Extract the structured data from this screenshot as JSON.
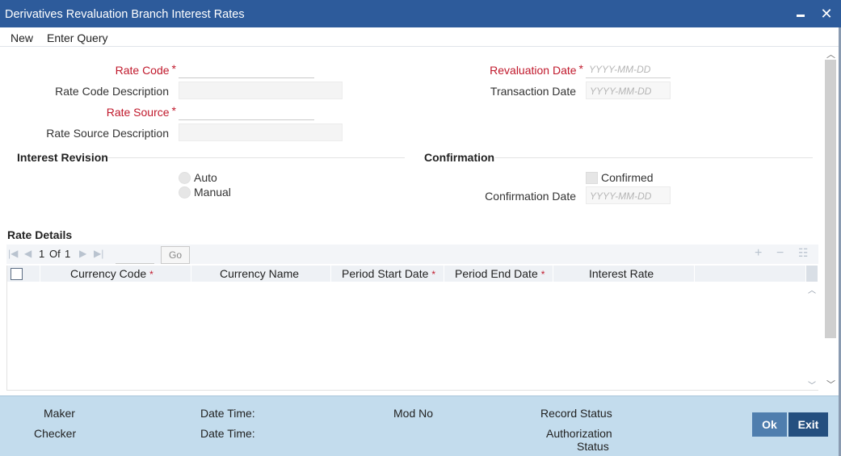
{
  "window": {
    "title": "Derivatives Revaluation Branch Interest Rates",
    "minimize_icon": "minimize-icon",
    "close_glyph": "✕"
  },
  "menu": {
    "new": "New",
    "enter_query": "Enter Query"
  },
  "form": {
    "rate_code_label": "Rate Code",
    "rate_code_desc_label": "Rate Code Description",
    "rate_source_label": "Rate Source",
    "rate_source_desc_label": "Rate Source Description",
    "revaluation_date_label": "Revaluation Date",
    "transaction_date_label": "Transaction Date",
    "date_placeholder": "YYYY-MM-DD",
    "required_mark": "*"
  },
  "interest_revision": {
    "title": "Interest Revision",
    "auto": "Auto",
    "manual": "Manual"
  },
  "confirmation": {
    "title": "Confirmation",
    "confirmed": "Confirmed",
    "confirmation_date_label": "Confirmation Date"
  },
  "rate_details": {
    "title": "Rate Details",
    "page_current": "1",
    "page_of": "Of",
    "page_total": "1",
    "go": "Go",
    "columns": [
      {
        "label": "Currency Code",
        "required": true
      },
      {
        "label": "Currency Name",
        "required": false
      },
      {
        "label": "Period Start Date",
        "required": true
      },
      {
        "label": "Period End Date",
        "required": true
      },
      {
        "label": "Interest Rate",
        "required": false
      }
    ],
    "rows": []
  },
  "footer": {
    "maker": "Maker",
    "checker": "Checker",
    "date_time_1": "Date Time:",
    "date_time_2": "Date Time:",
    "mod_no": "Mod No",
    "record_status": "Record Status",
    "authorization_status_line1": "Authorization",
    "authorization_status_line2": "Status",
    "ok": "Ok",
    "exit": "Exit"
  },
  "colors": {
    "titlebar": "#2d5b9b",
    "required": "#c0182b",
    "footer": "#c3dced",
    "ok_button": "#4f7eae",
    "exit_button": "#244f7f"
  }
}
